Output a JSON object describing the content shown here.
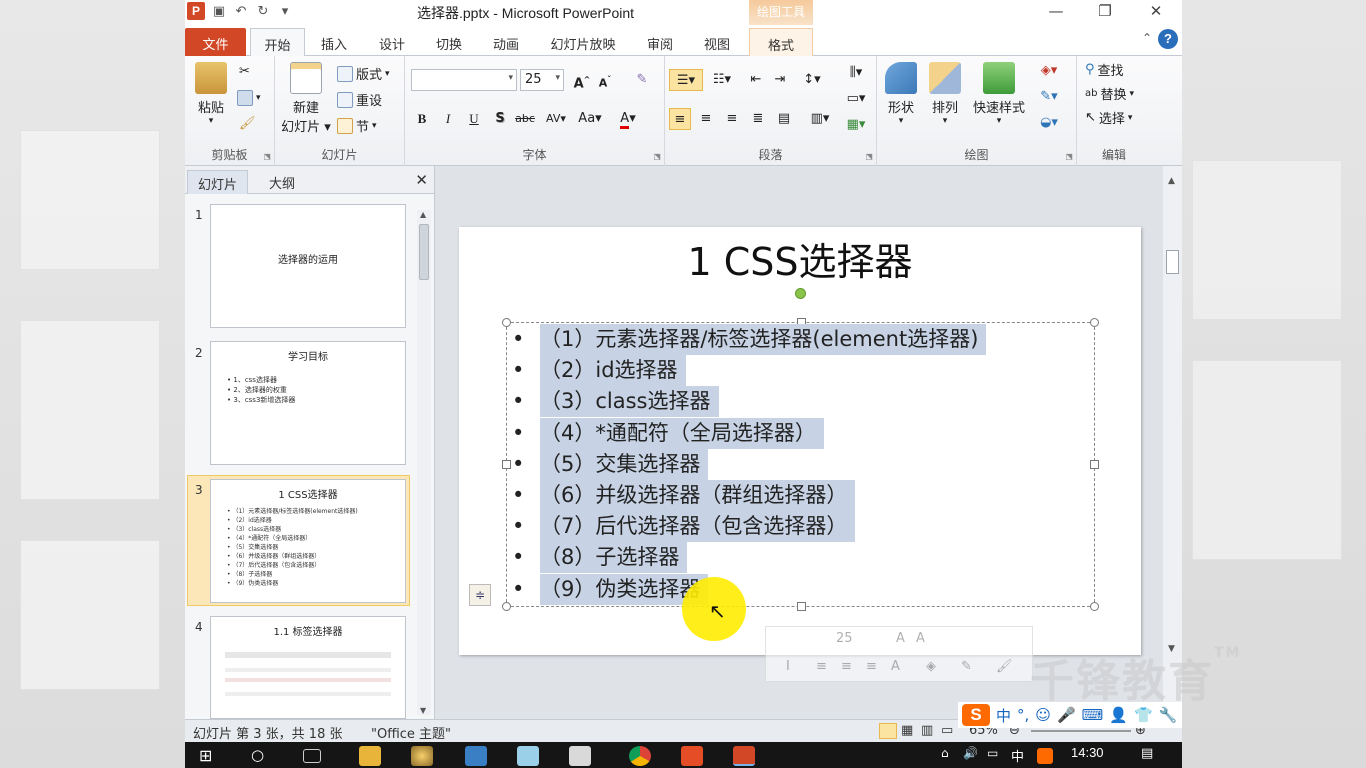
{
  "window": {
    "title": "选择器.pptx - Microsoft PowerPoint",
    "context_tools_label": "绘图工具",
    "minimize": "—",
    "restore": "❐",
    "close": "✕"
  },
  "tabs": [
    "文件",
    "开始",
    "插入",
    "设计",
    "切换",
    "动画",
    "幻灯片放映",
    "审阅",
    "视图",
    "格式"
  ],
  "active_tab": "开始",
  "ribbon": {
    "clipboard": {
      "paste": "粘贴",
      "label": "剪贴板"
    },
    "slides": {
      "new_slide_line1": "新建",
      "new_slide_line2": "幻灯片",
      "layout": "版式",
      "reset": "重设",
      "section": "节",
      "label": "幻灯片"
    },
    "font": {
      "font_name": "",
      "font_size": "25",
      "label": "字体",
      "bold": "B",
      "italic": "I",
      "underline": "U",
      "shadow": "S",
      "strike": "abc",
      "spacing": "AV",
      "case": "Aa",
      "color": "A",
      "grow": "A",
      "shrink": "A"
    },
    "paragraph": {
      "label": "段落"
    },
    "drawing": {
      "shape": "形状",
      "arrange": "排列",
      "quick_styles": "快速样式",
      "label": "绘图"
    },
    "editing": {
      "find": "查找",
      "replace": "替换",
      "select": "选择",
      "label": "编辑"
    }
  },
  "left_pane": {
    "tab_slides": "幻灯片",
    "tab_outline": "大纲",
    "close": "✕",
    "thumbnails": [
      {
        "num": "1",
        "title": "选择器的运用",
        "bullets": []
      },
      {
        "num": "2",
        "title": "学习目标",
        "bullets": [
          "1、css选择器",
          "2、选择器的权重",
          "3、css3新增选择器"
        ]
      },
      {
        "num": "3",
        "title": "1 CSS选择器",
        "bullets": [
          "（1）元素选择器/标签选择器(element选择器)",
          "（2）id选择器",
          "（3）class选择器",
          "（4）*通配符（全局选择器）",
          "（5）交集选择器",
          "（6）并级选择器（群组选择器）",
          "（7）后代选择器（包含选择器）",
          "（8）子选择器",
          "（9）伪类选择器"
        ]
      },
      {
        "num": "4",
        "title": "1.1 标签选择器",
        "bullets": []
      }
    ]
  },
  "slide": {
    "title": "1 CSS选择器",
    "bullet_char": "•",
    "items": [
      "（1）元素选择器/标签选择器(element选择器)",
      "（2）id选择器",
      "（3）class选择器",
      "（4）*通配符（全局选择器）",
      "（5）交集选择器",
      "（6）并级选择器（群组选择器）",
      "（7）后代选择器（包含选择器）",
      "（8）子选择器",
      "（9）伪类选择器"
    ],
    "mini_toolbar_size": "25"
  },
  "status": {
    "slide_info": "幻灯片 第 3 张，共 18 张",
    "theme": "\"Office 主题\"",
    "zoom": "65%"
  },
  "ime": {
    "logo": "S",
    "mode": "中"
  },
  "watermark": {
    "text": "千锋教育",
    "tm": "TM"
  },
  "taskbar": {
    "time": "14:30"
  },
  "colors": {
    "accent_file_tab": "#d24726",
    "selection_highlight": "#c7d3e5",
    "thumb_selected": "#fbe7b8"
  }
}
